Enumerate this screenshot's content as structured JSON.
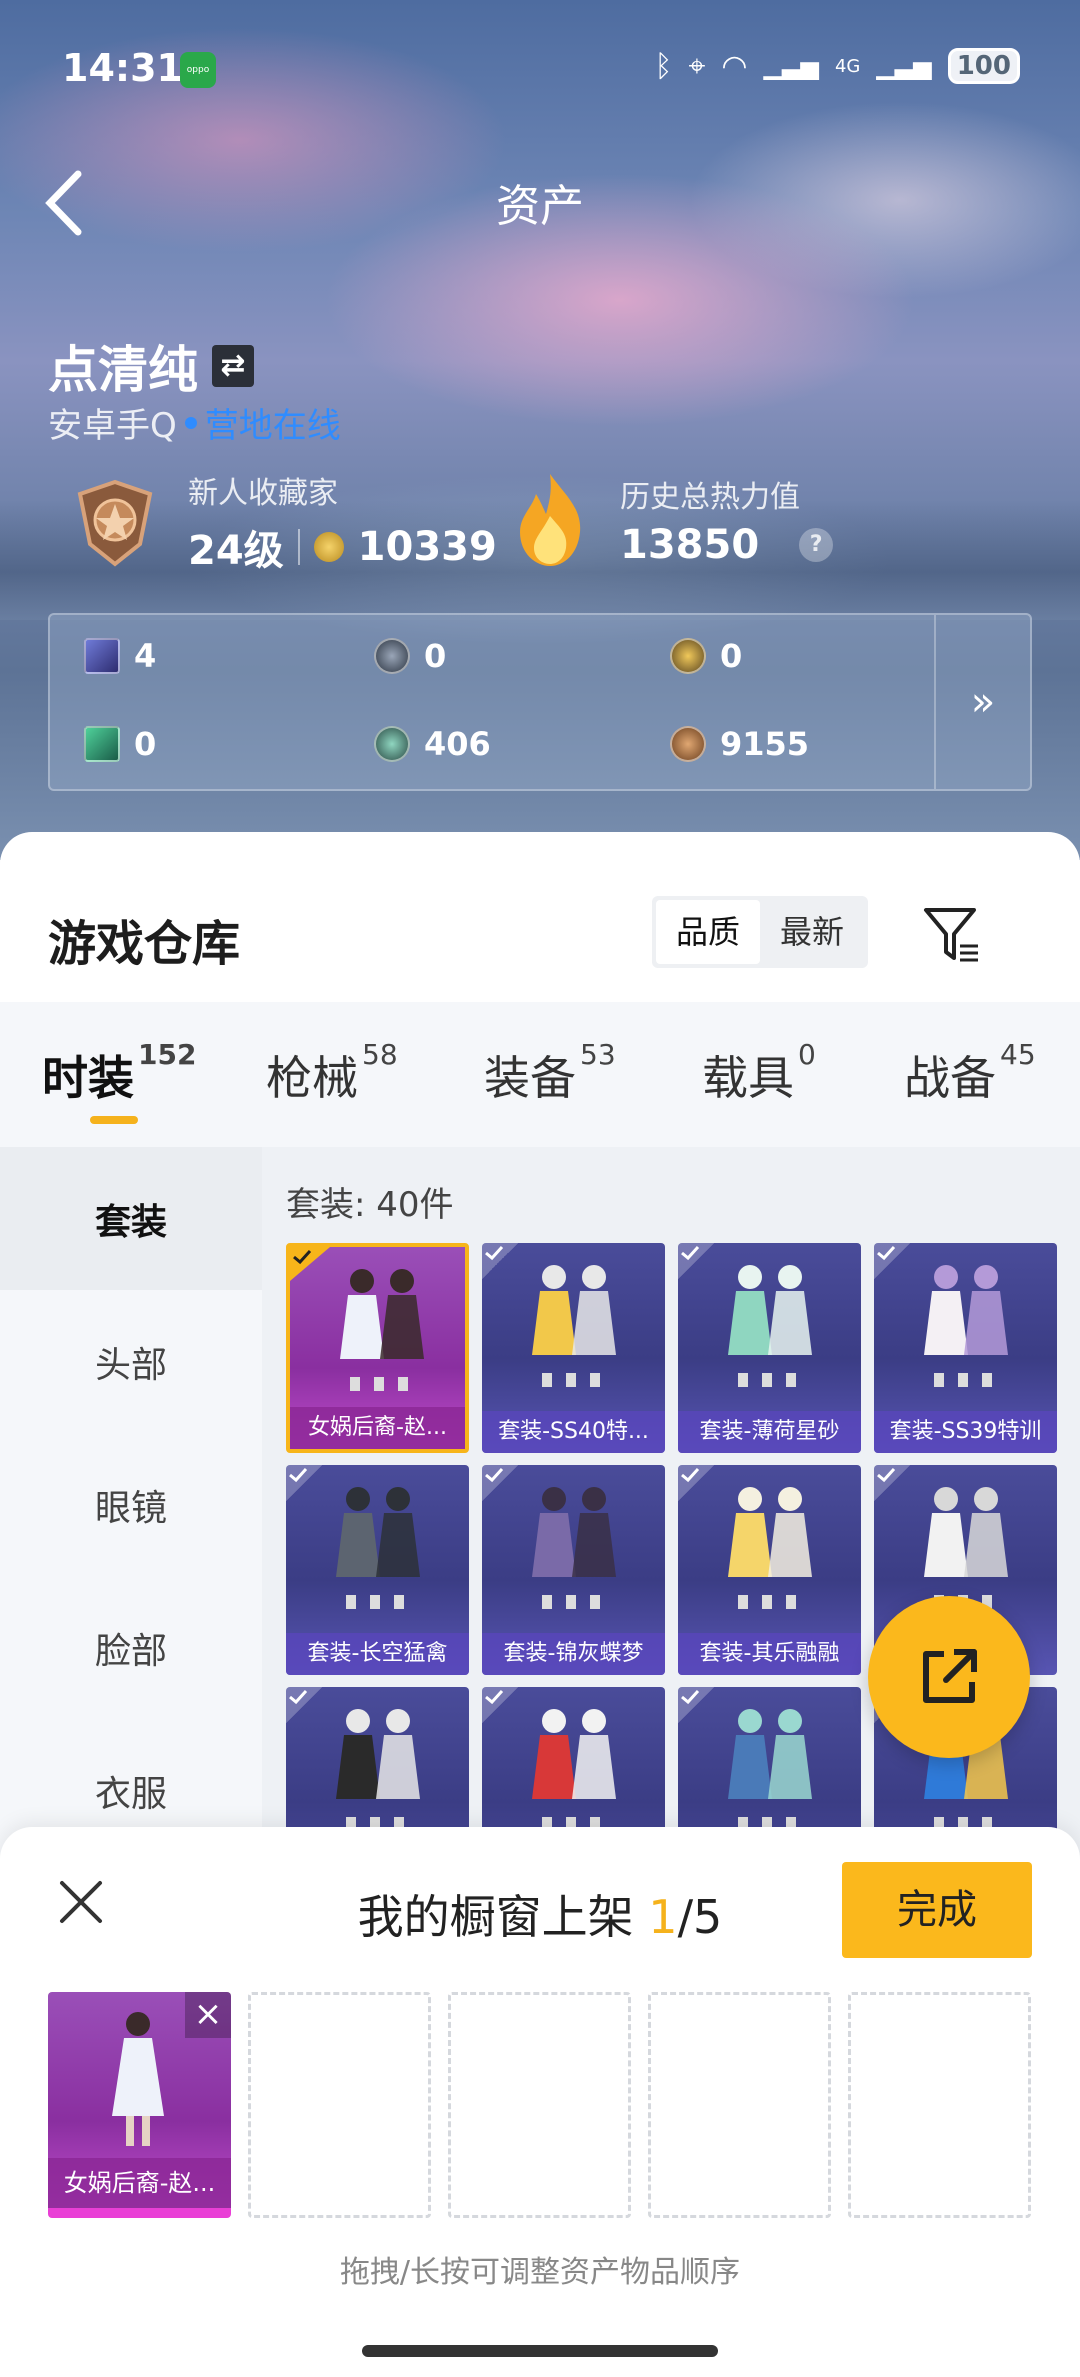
{
  "status_bar": {
    "time": "14:31",
    "battery": "100",
    "network": "4G"
  },
  "header": {
    "title": "资产"
  },
  "profile": {
    "name": "点清纯",
    "platform": "安卓手Q",
    "online_status": "营地在线",
    "rank_title": "新人收藏家",
    "level": "24级",
    "coins": "10339",
    "heat_label": "历史总热力值",
    "heat_value": "13850",
    "help": "?"
  },
  "currencies": [
    {
      "icon": "purple-card-icon",
      "value": "4"
    },
    {
      "icon": "silver-coin-icon",
      "value": "0"
    },
    {
      "icon": "gold-badge-icon",
      "value": "0"
    },
    {
      "icon": "green-card-icon",
      "value": "0"
    },
    {
      "icon": "green-coin-icon",
      "value": "406"
    },
    {
      "icon": "bronze-coin-icon",
      "value": "9155"
    }
  ],
  "currency_more": "»",
  "warehouse": {
    "title": "游戏仓库",
    "sort_options": [
      "品质",
      "最新"
    ],
    "sort_active": "品质"
  },
  "categories": [
    {
      "label": "时装",
      "count": "152"
    },
    {
      "label": "枪械",
      "count": "58"
    },
    {
      "label": "装备",
      "count": "53"
    },
    {
      "label": "载具",
      "count": "0"
    },
    {
      "label": "战备",
      "count": "45"
    }
  ],
  "sidebar": [
    "套装",
    "头部",
    "眼镜",
    "脸部",
    "衣服"
  ],
  "suit_count": "套装: 40件",
  "items": [
    {
      "label": "女娲后裔-赵...",
      "selected": true
    },
    {
      "label": "套装-SS40特..."
    },
    {
      "label": "套装-薄荷星砂"
    },
    {
      "label": "套装-SS39特训"
    },
    {
      "label": "套装-长空猛禽"
    },
    {
      "label": "套装-锦灰蝶梦"
    },
    {
      "label": "套装-其乐融融"
    },
    {
      "label": ""
    },
    {
      "label": ""
    },
    {
      "label": ""
    },
    {
      "label": ""
    },
    {
      "label": ""
    }
  ],
  "sheet": {
    "title_prefix": "我的橱窗上架 ",
    "count": "1",
    "total": "/5",
    "done": "完成",
    "slot_label": "女娲后裔-赵...",
    "remove": "×",
    "hint": "拖拽/长按可调整资产物品顺序"
  },
  "colors": {
    "accent": "#fbb81c",
    "online": "#2f8cff",
    "panel": "#ffffff"
  }
}
